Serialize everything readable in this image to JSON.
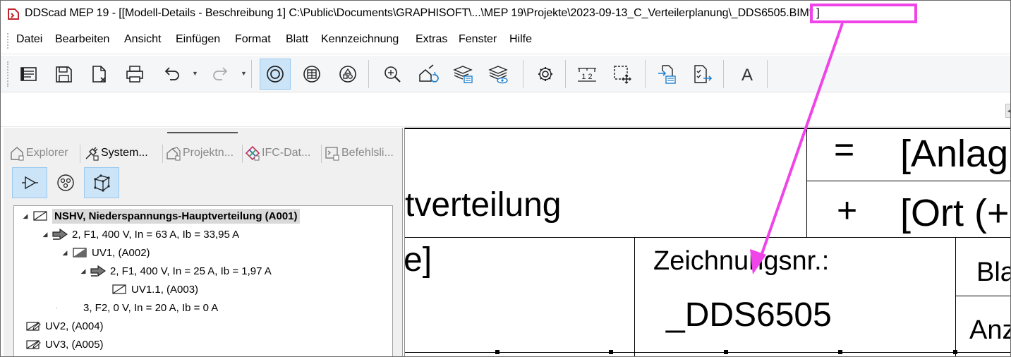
{
  "window": {
    "title": "DDScad MEP 19 - [[Modell-Details - Beschreibung 1]  C:\\Public\\Documents\\GRAPHISOFT\\...\\MEP 19\\Projekte\\2023-09-13_C_Verteilerplanung\\",
    "title_highlight": "_DDS6505.BIM*",
    "title_tail": " ]",
    "highlight_color": "#ee44e8"
  },
  "menu": {
    "items": [
      "Datei",
      "Bearbeiten",
      "Ansicht",
      "Einfügen",
      "Format",
      "Blatt",
      "Kennzeichnung",
      "Extras",
      "Fenster",
      "Hilfe"
    ]
  },
  "toolbar": {
    "buttons": [
      {
        "icon": "model-details-icon"
      },
      {
        "icon": "save-icon"
      },
      {
        "icon": "close-document-icon"
      },
      {
        "icon": "print-icon"
      },
      {
        "icon": "undo-icon"
      },
      {
        "icon": "redo-icon"
      },
      {
        "icon": "circle-view-icon",
        "active": true
      },
      {
        "icon": "panel-view-icon"
      },
      {
        "icon": "symbols-icon"
      },
      {
        "icon": "zoom-search-icon"
      },
      {
        "icon": "house-sync-icon"
      },
      {
        "icon": "layers-list-icon"
      },
      {
        "icon": "layers-eye-icon"
      },
      {
        "icon": "settings-icon"
      },
      {
        "icon": "numbering-icon"
      },
      {
        "icon": "select-move-icon"
      },
      {
        "icon": "import-icon"
      },
      {
        "icon": "export-list-icon"
      },
      {
        "icon": "text-icon"
      }
    ],
    "numbering_label": "1 2",
    "text_tool_label": "A"
  },
  "panel": {
    "tabs": [
      {
        "label": "Explorer",
        "icon": "explorer-house-icon",
        "active": false
      },
      {
        "label": "System...",
        "icon": "system-plug-icon",
        "active": true
      },
      {
        "label": "Projektn...",
        "icon": "project-house-icon",
        "active": false
      },
      {
        "label": "IFC-Dat...",
        "icon": "ifc-logo-icon",
        "active": false
      },
      {
        "label": "Befehlsli...",
        "icon": "command-list-icon",
        "active": false
      }
    ],
    "tools": [
      {
        "icon": "circuit-arrow-icon",
        "active": true
      },
      {
        "icon": "cable-cross-section-icon",
        "active": false
      },
      {
        "icon": "3d-cube-icon",
        "active": true
      }
    ],
    "tree": [
      {
        "label": "NSHV, Niederspannungs-Hauptverteilung (A001)",
        "type": "distribution",
        "level": 0,
        "expander": "◢",
        "selected": true
      },
      {
        "label": "2, F1, 400 V, In = 63 A, Ib = 33,95 A",
        "type": "circuit",
        "level": 1,
        "expander": "◢"
      },
      {
        "label": "UV1,  (A002)",
        "type": "distribution-filled",
        "level": 2,
        "expander": "◢"
      },
      {
        "label": "2, F1, 400 V, In = 25 A, Ib = 1,97 A",
        "type": "circuit",
        "level": 3,
        "expander": "◢"
      },
      {
        "label": "UV1.1,  (A003)",
        "type": "distribution",
        "level": 4,
        "expander": ""
      },
      {
        "label": "3, F2, 0 V, In = 20 A, Ib = 0 A",
        "type": "none",
        "level": 2,
        "expander": "·"
      },
      {
        "label": "UV2,  (A004)",
        "type": "distribution-edit",
        "level": 0,
        "expander": ""
      },
      {
        "label": "UV3,  (A005)",
        "type": "distribution-edit",
        "level": 0,
        "expander": ""
      }
    ]
  },
  "drawing": {
    "plant_prefix": "=",
    "plant_text": "[Anlag",
    "location_prefix": "+",
    "location_text": "[Ort (+",
    "title_fragment": "tverteilung",
    "bracket_fragment": "e]",
    "drawing_no_label": "Zeichnungsnr.:",
    "drawing_no_value": "_DDS6505",
    "sheet_label": "Bla",
    "count_label": "Anz"
  }
}
